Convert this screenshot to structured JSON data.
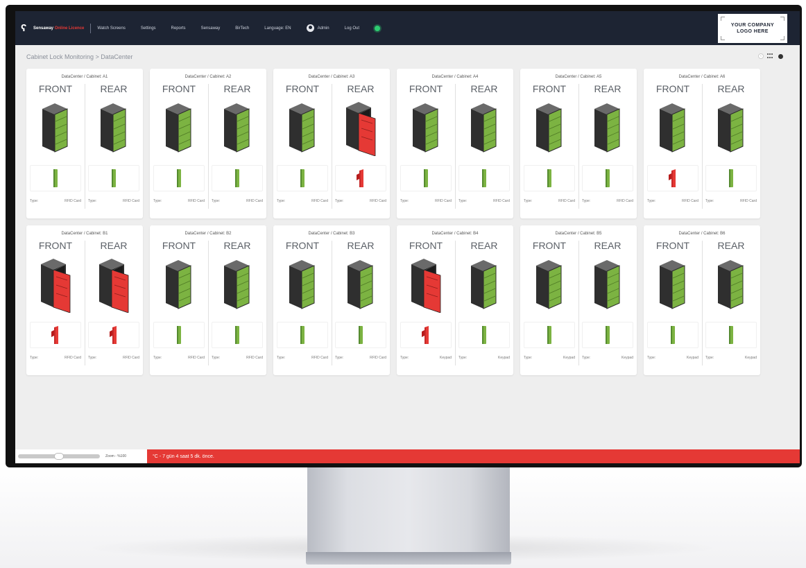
{
  "nav": {
    "brand": "Sensaway",
    "brand_sub": "Online Licence",
    "links": [
      "Watch Screens",
      "Settings",
      "Reports",
      "Sensaway",
      "BirTech",
      "Language: EN"
    ],
    "admin": "Admin",
    "logout": "Log Out"
  },
  "logo": {
    "line1": "YOUR COMPANY",
    "line2": "LOGO HERE"
  },
  "breadcrumb": "Cabinet Lock Monitoring > DataCenter",
  "labels": {
    "front": "FRONT",
    "rear": "REAR",
    "type_label": "Type:"
  },
  "colors": {
    "closed": "#7cb342",
    "open": "#e53935",
    "nav_bg": "#1d2433",
    "status_bar": "#e53935"
  },
  "cabinets": [
    {
      "title": "DataCenter / Cabinet: A1",
      "front": {
        "state": "closed",
        "lock": "locked",
        "type": "RFID Card"
      },
      "rear": {
        "state": "closed",
        "lock": "locked",
        "type": "RFID Card"
      }
    },
    {
      "title": "DataCenter / Cabinet: A2",
      "front": {
        "state": "closed",
        "lock": "locked",
        "type": "RFID Card"
      },
      "rear": {
        "state": "closed",
        "lock": "locked",
        "type": "RFID Card"
      }
    },
    {
      "title": "DataCenter / Cabinet: A3",
      "front": {
        "state": "closed",
        "lock": "locked",
        "type": "RFID Card"
      },
      "rear": {
        "state": "open",
        "lock": "unlocked",
        "type": "RFID Card"
      }
    },
    {
      "title": "DataCenter / Cabinet: A4",
      "front": {
        "state": "closed",
        "lock": "locked",
        "type": "RFID Card"
      },
      "rear": {
        "state": "closed",
        "lock": "locked",
        "type": "RFID Card"
      }
    },
    {
      "title": "DataCenter / Cabinet: A5",
      "front": {
        "state": "closed",
        "lock": "locked",
        "type": "RFID Card"
      },
      "rear": {
        "state": "closed",
        "lock": "locked",
        "type": "RFID Card"
      }
    },
    {
      "title": "DataCenter / Cabinet: A6",
      "front": {
        "state": "closed",
        "lock": "unlocked",
        "type": "RFID Card"
      },
      "rear": {
        "state": "closed",
        "lock": "locked",
        "type": "RFID Card"
      }
    },
    {
      "title": "DataCenter / Cabinet: B1",
      "front": {
        "state": "open",
        "lock": "unlocked",
        "type": "RFID Card"
      },
      "rear": {
        "state": "open",
        "lock": "unlocked",
        "type": "RFID Card"
      }
    },
    {
      "title": "DataCenter / Cabinet: B2",
      "front": {
        "state": "closed",
        "lock": "locked",
        "type": "RFID Card"
      },
      "rear": {
        "state": "closed",
        "lock": "locked",
        "type": "RFID Card"
      }
    },
    {
      "title": "DataCenter / Cabinet: B3",
      "front": {
        "state": "closed",
        "lock": "locked",
        "type": "RFID Card"
      },
      "rear": {
        "state": "closed",
        "lock": "locked",
        "type": "RFID Card"
      }
    },
    {
      "title": "DataCenter / Cabinet: B4",
      "front": {
        "state": "open",
        "lock": "unlocked",
        "type": "Keypad"
      },
      "rear": {
        "state": "closed",
        "lock": "locked",
        "type": "Keypad"
      }
    },
    {
      "title": "DataCenter / Cabinet: B5",
      "front": {
        "state": "closed",
        "lock": "locked",
        "type": "Keypad"
      },
      "rear": {
        "state": "closed",
        "lock": "locked",
        "type": "Keypad"
      }
    },
    {
      "title": "DataCenter / Cabinet: B6",
      "front": {
        "state": "closed",
        "lock": "locked",
        "type": "Keypad"
      },
      "rear": {
        "state": "closed",
        "lock": "locked",
        "type": "Keypad"
      }
    }
  ],
  "zoom_label": "Zoom - %100",
  "zoom_level": 0.5,
  "ticker": "°C - 7 gün 4 saat 5 dk. önce."
}
